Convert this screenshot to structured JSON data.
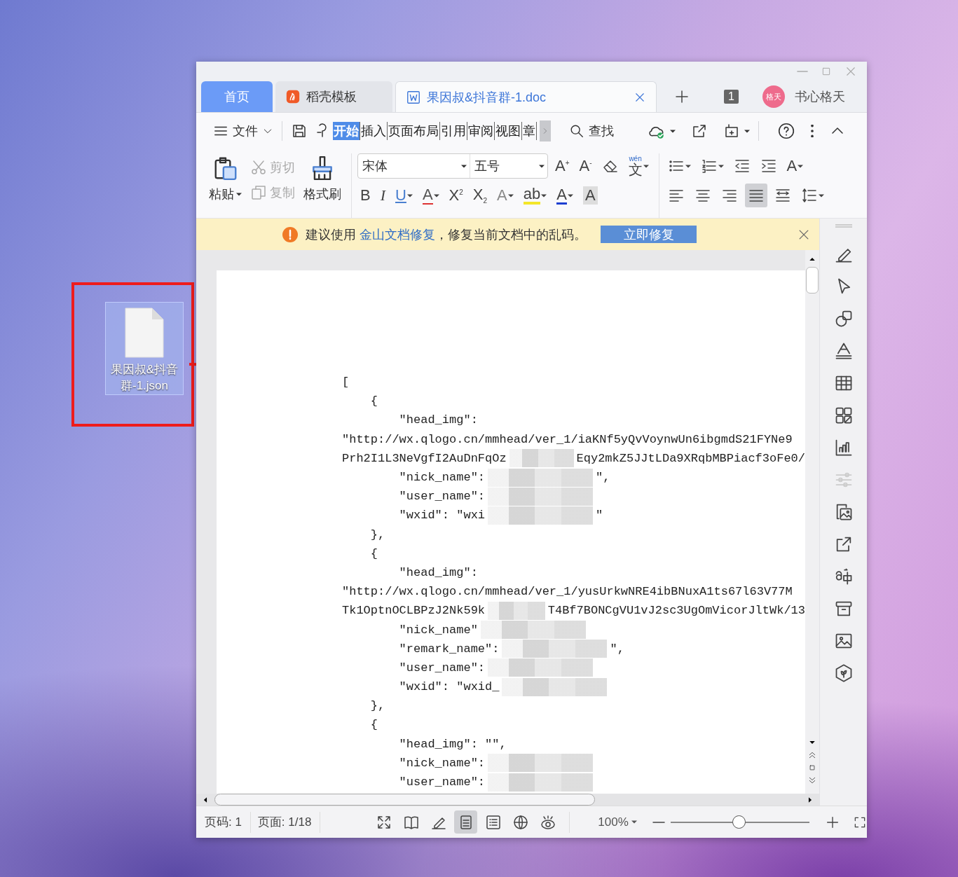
{
  "desktop_file": {
    "name": "果因叔&抖音群-1.json",
    "selected": true
  },
  "window": {
    "tabs": [
      {
        "kind": "home",
        "label": "首页",
        "selected": false
      },
      {
        "kind": "template",
        "label": "稻壳模板",
        "selected": false
      },
      {
        "kind": "document",
        "label": "果因叔&抖音群-1.doc",
        "selected": true
      }
    ],
    "window_count": "1",
    "user": {
      "avatar": "格天",
      "name": "书心格天"
    }
  },
  "menu": {
    "file": "文件",
    "tabs": [
      {
        "label": "开始",
        "selected": true
      },
      {
        "label": "插入",
        "selected": false
      },
      {
        "label": "页面布局",
        "selected": false
      },
      {
        "label": "引用",
        "selected": false
      },
      {
        "label": "审阅",
        "selected": false
      },
      {
        "label": "视图",
        "selected": false
      },
      {
        "label": "章",
        "selected": false
      }
    ],
    "search": "查找"
  },
  "ribbon": {
    "clipboard": [
      {
        "kind": "paste",
        "label": "粘贴",
        "disabled": false
      },
      {
        "kind": "cut",
        "label": "剪切",
        "disabled": true
      },
      {
        "kind": "copy",
        "label": "复制",
        "disabled": true
      },
      {
        "kind": "painter",
        "label": "格式刷",
        "disabled": false
      }
    ],
    "font": {
      "name": "宋体",
      "size": "五号"
    },
    "font_tools": [
      {
        "kind": "grow",
        "label": "A$^{+}$",
        "dropdown": false
      },
      {
        "kind": "shrink",
        "label": "A$^{-}$",
        "dropdown": false
      },
      {
        "kind": "clear",
        "dropdown": false
      },
      {
        "kind": "phonetic",
        "label": "文",
        "ruby": "wén",
        "dropdown": true
      }
    ],
    "format_tools": [
      {
        "kind": "bold",
        "label": "B",
        "dropdown": false
      },
      {
        "kind": "italic",
        "label": "I",
        "dropdown": false
      },
      {
        "kind": "underline",
        "label": "U",
        "dropdown": true
      },
      {
        "kind": "strike",
        "label": "A",
        "dropdown": true
      },
      {
        "kind": "superscript",
        "label": "X$^{2}$",
        "dropdown": false
      },
      {
        "kind": "subscript",
        "label": "X$_{2}$",
        "dropdown": false
      },
      {
        "kind": "effect",
        "label": "A",
        "dropdown": true
      },
      {
        "kind": "highlight",
        "label": "ab",
        "dropdown": true
      },
      {
        "kind": "color",
        "label": "A",
        "dropdown": true
      },
      {
        "kind": "shade",
        "label": "A",
        "dropdown": false
      }
    ],
    "para_tools": [
      {
        "kind": "bullets",
        "dropdown": true
      },
      {
        "kind": "numbering",
        "dropdown": true
      },
      {
        "kind": "outdent",
        "dropdown": false
      },
      {
        "kind": "indent",
        "dropdown": false
      },
      {
        "kind": "direction",
        "label": "A",
        "dropdown": true
      }
    ],
    "align_tools": [
      {
        "kind": "left",
        "selected": false
      },
      {
        "kind": "center",
        "selected": false
      },
      {
        "kind": "right",
        "selected": false
      },
      {
        "kind": "justify",
        "selected": true
      },
      {
        "kind": "distribute",
        "selected": false
      }
    ],
    "spacing_dropdown": true
  },
  "notice": {
    "prefix": "建议使用 ",
    "link": "金山文档修复",
    "suffix": "，修复当前文档中的乱码。",
    "button": "立即修复"
  },
  "document": {
    "lines": [
      {
        "kind": "bracket",
        "text": "[",
        "redacted": false
      },
      {
        "kind": "brace",
        "text": "{",
        "redacted": false
      },
      {
        "kind": "field",
        "text": "\"head_img\":",
        "redacted": false
      },
      {
        "kind": "wrap",
        "text": "\"http://wx.qlogo.cn/mmhead/ver_1/iaKNf5yQvVoynwUn6ibgmdS21FYNe9",
        "redacted": false
      },
      {
        "kind": "wrap",
        "text": "Prh2I1L3NeVgfI2AuDnFqOz",
        "redacted": true,
        "tail": "Eqy2mkZ5JJtLDa9XRqbMBPiacf3oFe0/"
      },
      {
        "kind": "field",
        "text": "\"nick_name\":",
        "redacted": true,
        "tail": "\","
      },
      {
        "kind": "field",
        "text": "\"user_name\":",
        "redacted": true
      },
      {
        "kind": "field",
        "text": "\"wxid\": \"wxi",
        "redacted": true,
        "tail": "\""
      },
      {
        "kind": "brace",
        "text": "},",
        "redacted": false
      },
      {
        "kind": "brace",
        "text": "{",
        "redacted": false
      },
      {
        "kind": "field",
        "text": "\"head_img\":",
        "redacted": false
      },
      {
        "kind": "wrap",
        "text": "\"http://wx.qlogo.cn/mmhead/ver_1/yusUrkwNRE4ibBNuxA1ts67l63V77M",
        "redacted": false
      },
      {
        "kind": "wrap",
        "text": "Tk1OptnOCLBPzJ2Nk59k",
        "redacted": true,
        "tail": "T4Bf7BONCgVU1vJ2sc3UgOmVicorJltWk/13"
      },
      {
        "kind": "field",
        "text": "\"nick_name\"",
        "redacted": true
      },
      {
        "kind": "field",
        "text": "\"remark_name\":",
        "redacted": true,
        "tail": "\","
      },
      {
        "kind": "field",
        "text": "\"user_name\":",
        "redacted": true
      },
      {
        "kind": "field",
        "text": "\"wxid\": \"wxid_",
        "redacted": true
      },
      {
        "kind": "brace",
        "text": "},",
        "redacted": false
      },
      {
        "kind": "brace",
        "text": "{",
        "redacted": false
      },
      {
        "kind": "field",
        "text": "\"head_img\": \"\",",
        "redacted": false
      },
      {
        "kind": "field",
        "text": "\"nick_name\":",
        "redacted": true
      },
      {
        "kind": "field",
        "text": "\"user_name\":",
        "redacted": true
      }
    ]
  },
  "side_tools": [
    {
      "kind": "pen",
      "disabled": false
    },
    {
      "kind": "cursor",
      "disabled": false
    },
    {
      "kind": "shapes",
      "disabled": false
    },
    {
      "kind": "textart",
      "disabled": false
    },
    {
      "kind": "table",
      "disabled": false
    },
    {
      "kind": "apps",
      "disabled": false
    },
    {
      "kind": "chart",
      "disabled": false
    },
    {
      "kind": "sliders",
      "disabled": true
    },
    {
      "kind": "picture-doc",
      "disabled": false
    },
    {
      "kind": "share",
      "disabled": false
    },
    {
      "kind": "translate",
      "disabled": false
    },
    {
      "kind": "archive",
      "disabled": false
    },
    {
      "kind": "image",
      "disabled": false
    },
    {
      "kind": "shield",
      "disabled": false
    }
  ],
  "status_bar": {
    "page_number": "页码: 1",
    "pages": "页面: 1/18",
    "views": [
      {
        "kind": "fullscreen",
        "selected": false
      },
      {
        "kind": "book",
        "selected": false
      },
      {
        "kind": "pen",
        "selected": false
      },
      {
        "kind": "page",
        "selected": true
      },
      {
        "kind": "outline",
        "selected": false
      },
      {
        "kind": "web",
        "selected": false
      },
      {
        "kind": "eye",
        "selected": false
      }
    ],
    "zoom": "100%",
    "zoom_slider": {
      "level": 0.49
    }
  }
}
